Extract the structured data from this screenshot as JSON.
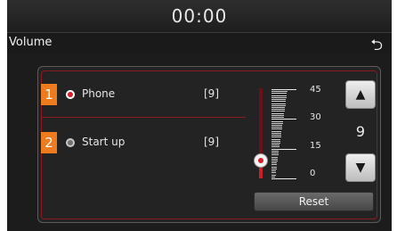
{
  "statusbar": {
    "time": "00:00"
  },
  "header": {
    "title": "Volume",
    "back_icon": "return-arrow-icon"
  },
  "list": {
    "items": [
      {
        "number": "1",
        "label": "Phone",
        "value": "[9]",
        "selected": true
      },
      {
        "number": "2",
        "label": "Start up",
        "value": "[9]",
        "selected": false
      }
    ]
  },
  "volume": {
    "scale_labels": [
      "45",
      "30",
      "15",
      "0"
    ],
    "current": "9",
    "level": 9,
    "max": 45,
    "up_icon": "triangle-up-icon",
    "down_icon": "triangle-down-icon",
    "reset_label": "Reset"
  },
  "colors": {
    "accent_red": "#d61e2b",
    "number_badge": "#f07b1e",
    "background": "#1c1c1c"
  }
}
